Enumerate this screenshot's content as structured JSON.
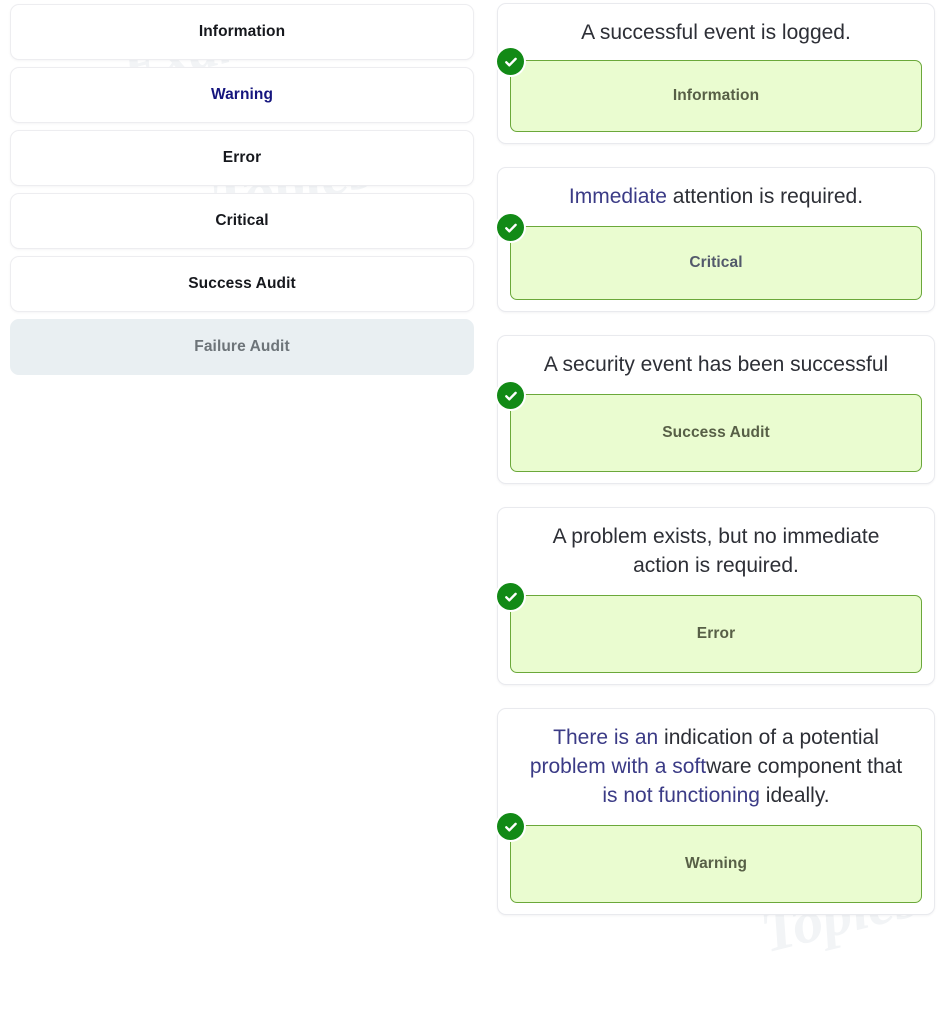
{
  "source_list": {
    "items": [
      {
        "label": "Information",
        "state": "default"
      },
      {
        "label": "Warning",
        "state": "selected-text"
      },
      {
        "label": "Error",
        "state": "default"
      },
      {
        "label": "Critical",
        "state": "default"
      },
      {
        "label": "Success Audit",
        "state": "default"
      },
      {
        "label": "Failure Audit",
        "state": "active"
      }
    ]
  },
  "cards": [
    {
      "prompt": "A successful event is logged.",
      "answer": "Information",
      "status_icon": "check-circle-icon"
    },
    {
      "prompt_parts": [
        {
          "text": "Immediate",
          "selected": true
        },
        {
          "text": " attention is required.",
          "selected": false
        }
      ],
      "prompt": "Immediate attention is required.",
      "answer": "Critical",
      "status_icon": "check-circle-icon"
    },
    {
      "prompt": "A security event has been successful",
      "answer": "Success Audit",
      "status_icon": "check-circle-icon"
    },
    {
      "prompt": "A problem exists, but no immediate action is required.",
      "answer": "Error",
      "status_icon": "check-circle-icon"
    },
    {
      "prompt_parts": [
        {
          "text": "There is an",
          "selected": true
        },
        {
          "text": " indication of a potential ",
          "selected": false
        },
        {
          "text": "problem with a soft",
          "selected": true
        },
        {
          "text": "ware component that ",
          "selected": false
        },
        {
          "text": "is not functioning",
          "selected": true
        },
        {
          "text": " ideally.",
          "selected": false
        }
      ],
      "prompt": "There is an indication of a potential problem with a software component that is not functioning ideally.",
      "answer": "Warning",
      "status_icon": "check-circle-icon"
    }
  ],
  "colors": {
    "drop_fill": "#eafcd0",
    "drop_border": "#6ba83a",
    "check_badge": "#128a16",
    "active_item_bg": "#e9eff2",
    "selected_text": "#15157e"
  },
  "watermarks": [
    "Exam",
    "Topics",
    "Exam",
    "Topics",
    "Exam",
    "Topics"
  ]
}
